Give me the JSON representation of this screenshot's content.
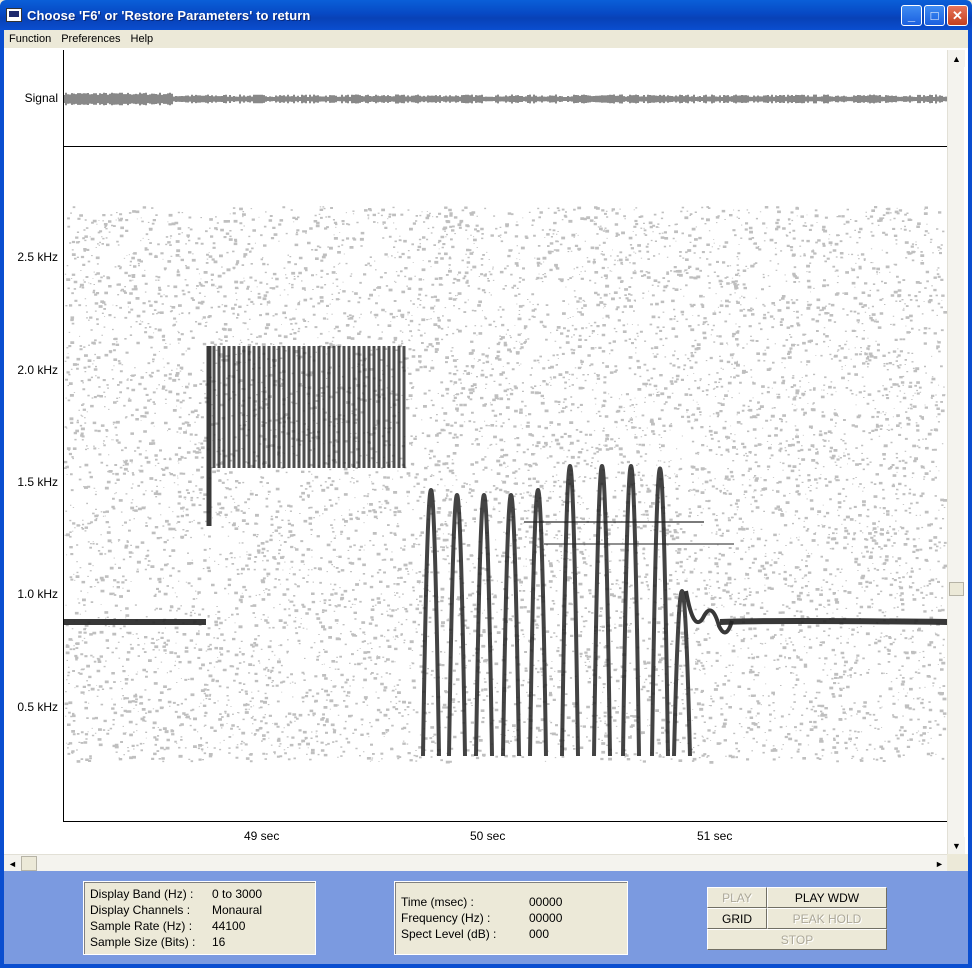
{
  "window": {
    "title": "Choose 'F6' or 'Restore Parameters' to return",
    "minimize_glyph": "_",
    "maximize_glyph": "□",
    "close_glyph": "✕"
  },
  "menu": [
    "Function",
    "Preferences",
    "Help"
  ],
  "plot": {
    "signal_label": "Signal",
    "y_ticks": [
      "2.5 kHz",
      "2.0 kHz",
      "1.5 kHz",
      "1.0 kHz",
      "0.5 kHz"
    ],
    "x_ticks": [
      "49  sec",
      "50  sec",
      "51  sec"
    ],
    "colors": {
      "ink": "#222222",
      "noise": "#8a8a8a",
      "background": "#ffffff"
    }
  },
  "settings": {
    "rows": [
      {
        "key": "Display Band (Hz) :",
        "value": "0 to 3000"
      },
      {
        "key": "Display Channels :",
        "value": "Monaural"
      },
      {
        "key": "Sample Rate (Hz) :",
        "value": "44100"
      },
      {
        "key": "Sample Size (Bits) :",
        "value": "16"
      }
    ]
  },
  "readout": {
    "rows": [
      {
        "key": "Time (msec) :",
        "value": "00000"
      },
      {
        "key": "Frequency (Hz) :",
        "value": "00000"
      },
      {
        "key": "Spect Level (dB) :",
        "value": "000"
      }
    ]
  },
  "buttons": {
    "play": "PLAY",
    "play_wdw": "PLAY WDW",
    "grid": "GRID",
    "peak_hold": "PEAK HOLD",
    "stop": "STOP"
  },
  "scrollbars": {
    "up": "▲",
    "down": "▼",
    "left": "◄",
    "right": "►"
  }
}
